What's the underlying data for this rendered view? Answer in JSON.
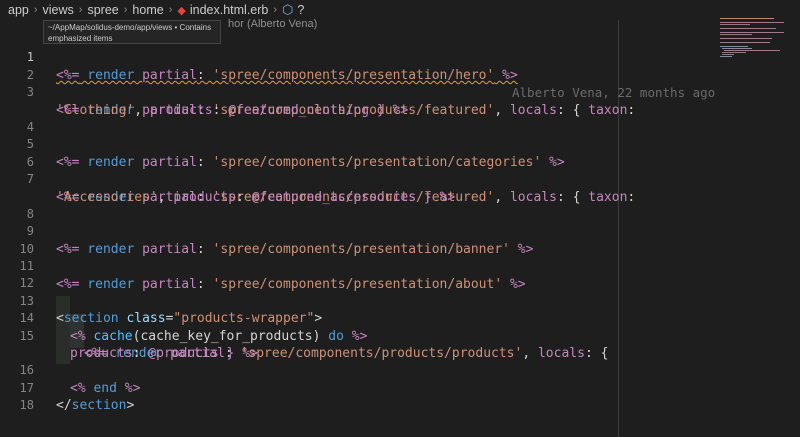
{
  "breadcrumb": {
    "items": [
      "app",
      "views",
      "spree",
      "home"
    ],
    "file": "index.html.erb",
    "extra": "?"
  },
  "tooltip": {
    "line1": "~/AppMap/solidus-demo/app/views • Contains",
    "line2": "emphasized items"
  },
  "blame_header": "hor (Alberto Vena)",
  "blame_inline": "Alberto Vena, 22 months ago •",
  "line_numbers": [
    "1",
    "2",
    "3",
    "",
    "4",
    "5",
    "6",
    "7",
    "",
    "8",
    "9",
    "10",
    "11",
    "12",
    "13",
    "14",
    "15",
    "",
    "16",
    "17",
    "18"
  ],
  "code": {
    "l1": {
      "open": "<%=",
      "kw": " render ",
      "sym": "partial",
      "colon": ":",
      "str": " 'spree/components/presentation/hero'",
      "close": " %>"
    },
    "l3a": {
      "open": "<%=",
      "kw": " render ",
      "sym": "partial",
      "colon": ":",
      "str": " 'spree/components/products/featured'",
      "comma": ",",
      "sym2": " locals",
      "brace": ": { ",
      "sym3": "taxon",
      "colon2": ":"
    },
    "l3b": {
      "str": "'Clothing'",
      "comma": ", ",
      "sym": "products",
      "colon": ": ",
      "ivar": "@featured_clothing",
      "close": " } %>"
    },
    "l5": {
      "open": "<%=",
      "kw": " render ",
      "sym": "partial",
      "colon": ":",
      "str": " 'spree/components/presentation/categories'",
      "close": " %>"
    },
    "l7a": {
      "open": "<%=",
      "kw": " render ",
      "sym": "partial",
      "colon": ":",
      "str": " 'spree/components/products/featured'",
      "comma": ",",
      "sym2": " locals",
      "brace": ": { ",
      "sym3": "taxon",
      "colon2": ":"
    },
    "l7b": {
      "str": "'Accessories'",
      "comma": ", ",
      "sym": "products",
      "colon": ": ",
      "ivar": "@featured_accessories",
      "close": " } %>"
    },
    "l9": {
      "open": "<%=",
      "kw": " render ",
      "sym": "partial",
      "colon": ":",
      "str": " 'spree/components/presentation/banner'",
      "close": " %>"
    },
    "l11": {
      "open": "<%=",
      "kw": " render ",
      "sym": "partial",
      "colon": ":",
      "str": " 'spree/components/presentation/about'",
      "close": " %>"
    },
    "l13": {
      "lt": "<",
      "tag": "section",
      "attr": " class",
      "eq": "=",
      "val": "\"products-wrapper\"",
      "gt": ">"
    },
    "l14": {
      "open": "<%",
      "fn": " cache",
      "args": "(cache_key_for_products)",
      "kw": " do",
      "close": " %>"
    },
    "l15a": {
      "open": "<%=",
      "kw": " render ",
      "sym": "partial",
      "colon": ":",
      "str": " 'spree/components/products/products'",
      "comma": ",",
      "sym2": " locals",
      "brace": ": {"
    },
    "l15b": {
      "sym": "products",
      "colon": ": ",
      "ivar": "@products",
      "close": " } %>"
    },
    "l16": {
      "open": "<%",
      "kw": " end",
      "close": " %>"
    },
    "l17": {
      "lt": "</",
      "tag": "section",
      "gt": ">"
    }
  },
  "colors": {
    "background": "#1e1e1e",
    "erb_delimiter": "#c586c0",
    "keyword": "#569cd6",
    "string": "#ce9178"
  }
}
